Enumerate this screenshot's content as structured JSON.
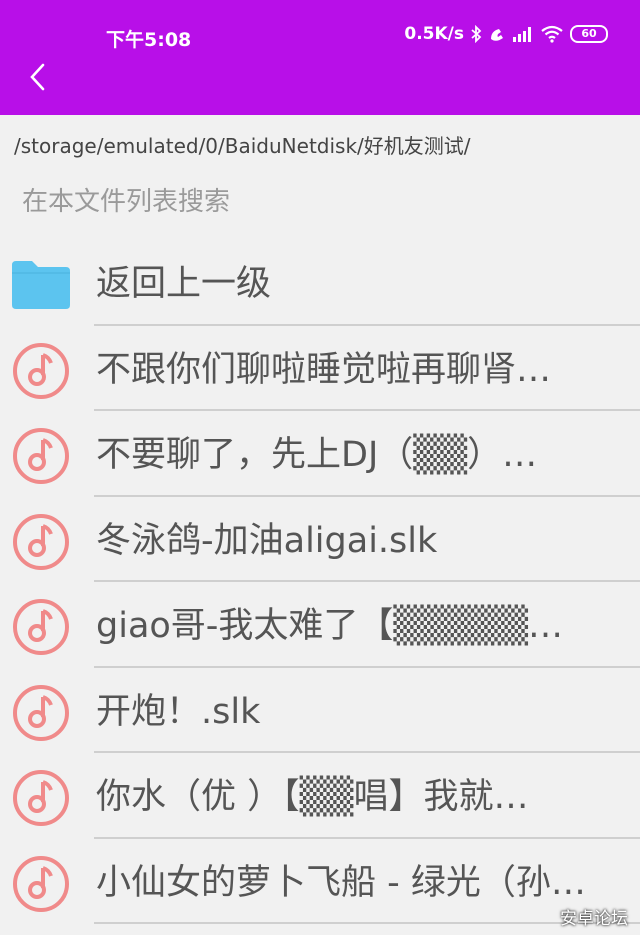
{
  "status_bar": {
    "time": "下午5:08",
    "net_speed": "0.5K/s",
    "battery": "60"
  },
  "header": {
    "back_icon": "chevron-left-icon"
  },
  "path": "/storage/emulated/0/BaiduNetdisk/好机友测试/",
  "search": {
    "placeholder": "在本文件列表搜索"
  },
  "list": {
    "items": [
      {
        "label": "返回上一级",
        "icon": "folder-icon"
      },
      {
        "label": "不跟你们聊啦睡觉啦再聊肾…",
        "icon": "music-icon"
      },
      {
        "label": "不要聊了，先上DJ（▒▒）…",
        "icon": "music-icon"
      },
      {
        "label": "冬泳鸽-加油aligai.slk",
        "icon": "music-icon"
      },
      {
        "label": "giao哥-我太难了【▒▒▒▒▒…",
        "icon": "music-icon"
      },
      {
        "label": "开炮！.slk",
        "icon": "music-icon"
      },
      {
        "label": "你水（优 ）【▒▒唱】我就…",
        "icon": "music-icon"
      },
      {
        "label": "小仙女的萝卜飞船 - 绿光（孙…",
        "icon": "music-icon"
      }
    ]
  },
  "watermark": "安卓论坛",
  "colors": {
    "accent": "#b80fe8",
    "folder": "#5cc4ef",
    "music": "#f08a8a"
  }
}
